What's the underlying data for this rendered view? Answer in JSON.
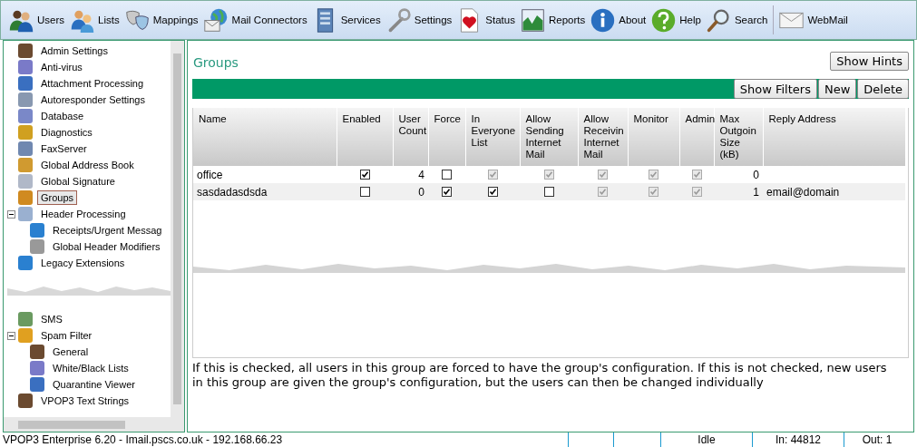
{
  "toolbar": [
    {
      "label": "Users"
    },
    {
      "label": "Lists"
    },
    {
      "label": "Mappings"
    },
    {
      "label": "Mail Connectors"
    },
    {
      "label": "Services"
    },
    {
      "label": "Settings"
    },
    {
      "label": "Status"
    },
    {
      "label": "Reports"
    },
    {
      "label": "About"
    },
    {
      "label": "Help"
    },
    {
      "label": "Search"
    },
    {
      "label": "WebMail"
    }
  ],
  "sidebar": {
    "items": [
      {
        "label": "Admin Settings",
        "selected": false
      },
      {
        "label": "Anti-virus",
        "selected": false
      },
      {
        "label": "Attachment Processing",
        "selected": false
      },
      {
        "label": "Autoresponder Settings",
        "selected": false
      },
      {
        "label": "Database",
        "selected": false
      },
      {
        "label": "Diagnostics",
        "selected": false
      },
      {
        "label": "FaxServer",
        "selected": false
      },
      {
        "label": "Global Address Book",
        "selected": false
      },
      {
        "label": "Global Signature",
        "selected": false
      },
      {
        "label": "Groups",
        "selected": true
      },
      {
        "label": "Header Processing",
        "selected": false,
        "expanded": true,
        "children": [
          {
            "label": "Receipts/Urgent Messag",
            "selected": false
          },
          {
            "label": "Global Header Modifiers",
            "selected": false
          }
        ]
      },
      {
        "label": "Legacy Extensions",
        "selected": false
      },
      {
        "kind": "tear"
      },
      {
        "label": "SMS",
        "selected": false
      },
      {
        "label": "Spam Filter",
        "selected": false,
        "expanded": true,
        "children": [
          {
            "label": "General",
            "selected": false
          },
          {
            "label": "White/Black Lists",
            "selected": false
          },
          {
            "label": "Quarantine Viewer",
            "selected": false
          }
        ]
      },
      {
        "label": "VPOP3 Text Strings",
        "selected": false
      }
    ]
  },
  "main": {
    "title": "Groups",
    "hint_button": "Show Hints",
    "actions": [
      "Show Filters",
      "New",
      "Delete"
    ],
    "table": {
      "columns": [
        "Name",
        "Enabled",
        "User Count",
        "Force",
        "In Everyone List",
        "Allow Sending Internet Mail",
        "Allow Receivin Internet Mail",
        "Monitor",
        "Admin",
        "Max Outgoin Size (kB)",
        "Reply Address"
      ],
      "rows": [
        {
          "selected": false,
          "cells": [
            {
              "kind": "text",
              "text": "office"
            },
            {
              "kind": "check",
              "checked": true,
              "disabled": false
            },
            {
              "kind": "number",
              "text": "4"
            },
            {
              "kind": "check",
              "checked": false,
              "disabled": false
            },
            {
              "kind": "check",
              "checked": true,
              "disabled": true
            },
            {
              "kind": "check",
              "checked": true,
              "disabled": true
            },
            {
              "kind": "check",
              "checked": true,
              "disabled": true
            },
            {
              "kind": "check",
              "checked": true,
              "disabled": true
            },
            {
              "kind": "check",
              "checked": true,
              "disabled": true
            },
            {
              "kind": "number",
              "text": "0"
            },
            {
              "kind": "text",
              "text": ""
            }
          ]
        },
        {
          "selected": true,
          "cells": [
            {
              "kind": "text",
              "text": "sasdadasdsda"
            },
            {
              "kind": "check",
              "checked": false,
              "disabled": false
            },
            {
              "kind": "number",
              "text": "0"
            },
            {
              "kind": "check",
              "checked": true,
              "disabled": false
            },
            {
              "kind": "check",
              "checked": true,
              "disabled": false
            },
            {
              "kind": "check",
              "checked": false,
              "disabled": false
            },
            {
              "kind": "check",
              "checked": true,
              "disabled": true
            },
            {
              "kind": "check",
              "checked": true,
              "disabled": true
            },
            {
              "kind": "check",
              "checked": true,
              "disabled": true
            },
            {
              "kind": "number",
              "text": "1"
            },
            {
              "kind": "text",
              "text": "email@domain"
            }
          ]
        }
      ]
    },
    "help_text": "If this is checked, all users in this group are forced to have the group's configuration. If this is not checked, new users in this group are given the group's configuration, but the users can then be changed individually"
  },
  "status_bar": {
    "server": "VPOP3 Enterprise 6.20 - Imail.pscs.co.uk - 192.168.66.23",
    "state": "Idle",
    "in": "In: 44812",
    "out": "Out: 1"
  }
}
